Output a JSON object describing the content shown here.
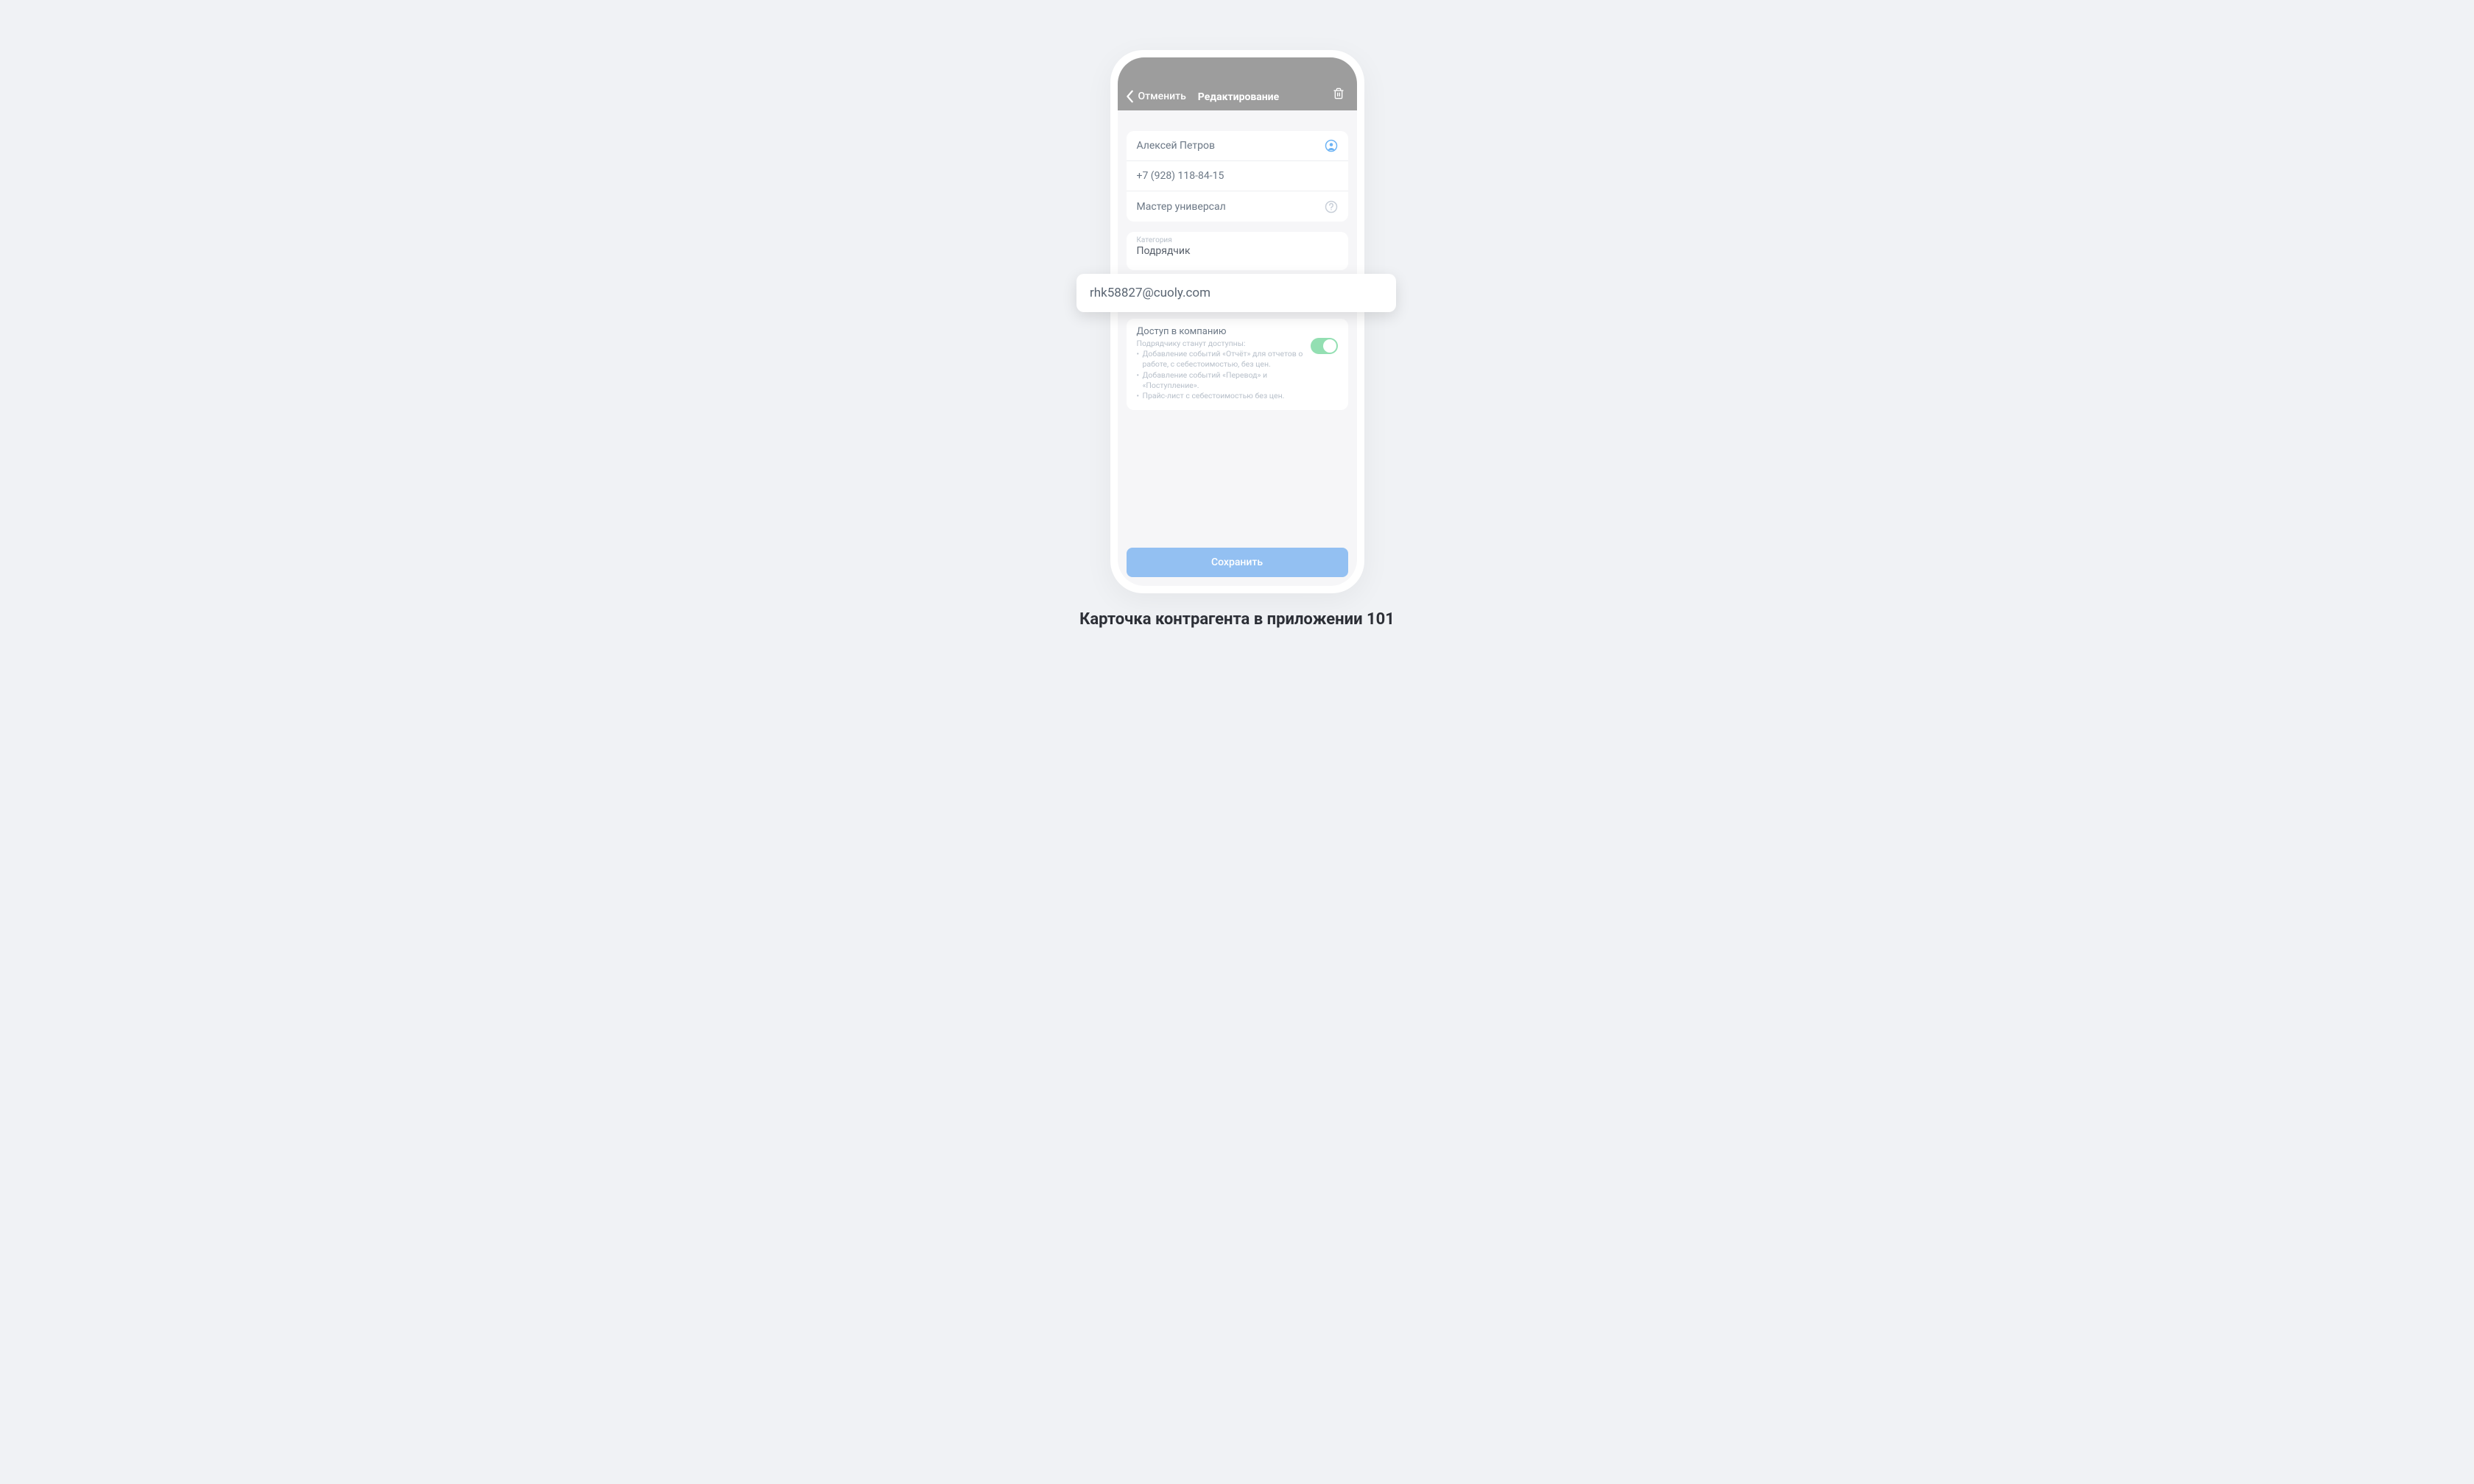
{
  "header": {
    "cancel": "Отменить",
    "title": "Редактирование"
  },
  "fields": {
    "name": "Алексей Петров",
    "phone": "+7 (928) 118-84-15",
    "role": "Мастер универсал"
  },
  "category": {
    "label": "Категория",
    "value": "Подрядчик"
  },
  "popover": {
    "email": "rhk58827@cuoly.com"
  },
  "access": {
    "title": "Доступ в компанию",
    "subtitle": "Подрядчику станут доступны:",
    "items": [
      "Добавление событий «Отчёт» для отчетов о работе, с себестоимостью, без цен.",
      "Добавление событий «Перевод» и «Поступление».",
      "Прайс-лист с себестоимостью без цен."
    ],
    "enabled": true
  },
  "footer": {
    "save": "Сохранить"
  },
  "caption": "Карточка контрагента в приложении 101",
  "colors": {
    "headerBg": "#9d9d9d",
    "accentBlue": "#93c0f2",
    "toggleGreen": "#93dfb2"
  }
}
